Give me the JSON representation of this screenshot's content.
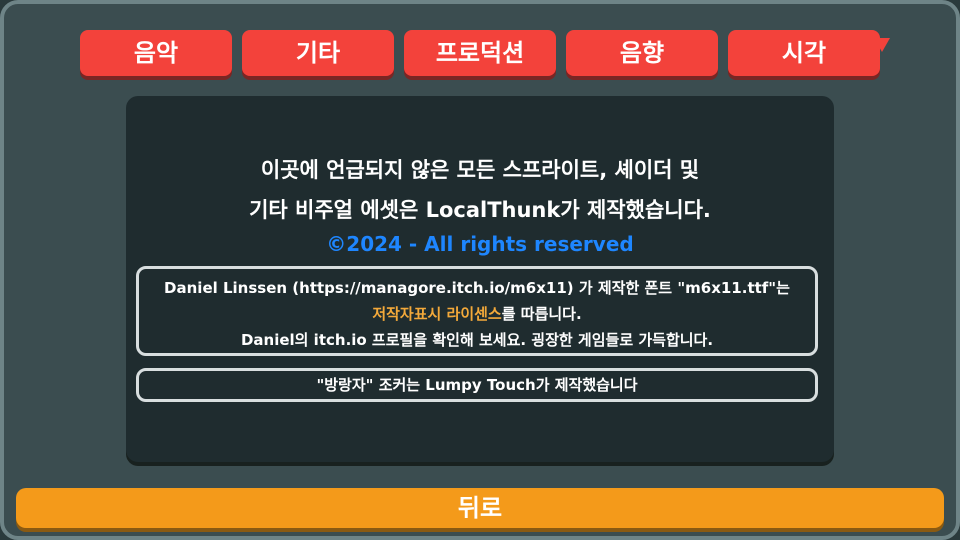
{
  "tabs": [
    {
      "label": "음악"
    },
    {
      "label": "기타"
    },
    {
      "label": "프로덕션"
    },
    {
      "label": "음향"
    },
    {
      "label": "시각"
    }
  ],
  "active_tab_index": 4,
  "panel": {
    "line1": "이곳에 언급되지 않은 모든 스프라이트, 셰이더 및",
    "line2": "기타 비주얼 에셋은 LocalThunk가 제작했습니다.",
    "copyright": "©2024 - All rights reserved",
    "font_credit": {
      "line1": "Daniel Linssen (https://managore.itch.io/m6x11) 가 제작한 폰트 \"m6x11.ttf\"는",
      "line2_highlight": "저작자표시 라이센스",
      "line2_rest": "를 따릅니다.",
      "line3": "Daniel의 itch.io 프로필을 확인해 보세요. 굉장한 게임들로 가득합니다."
    },
    "joker_credit": "\"방랑자\" 조커는 Lumpy Touch가 제작했습니다"
  },
  "back_button": {
    "label": "뒤로"
  },
  "colors": {
    "tab_red": "#f3423b",
    "back_orange": "#f49a1a",
    "copyright_blue": "#1e86ff",
    "highlight_orange": "#f3a93a",
    "panel_dark": "#1f2c2f",
    "frame": "#3b4d50"
  }
}
